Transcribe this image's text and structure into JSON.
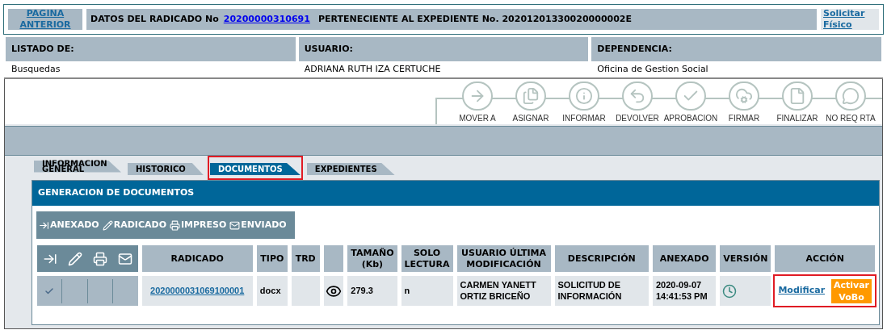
{
  "header": {
    "back_link": "PAGINA ANTERIOR",
    "title_prefix": "DATOS DEL RADICADO No",
    "radicado_link": "20200000310691",
    "title_suffix": "PERTENECIENTE AL EXPEDIENTE No. 20201201330020000002E",
    "request_link": "Solicitar Físico"
  },
  "info": [
    {
      "label": "LISTADO DE:",
      "value": "Busquedas"
    },
    {
      "label": "USUARIO:",
      "value": "ADRIANA RUTH IZA CERTUCHE"
    },
    {
      "label": "DEPENDENCIA:",
      "value": "Oficina de Gestion Social"
    }
  ],
  "workflow_actions": [
    {
      "kind": "move",
      "label": "MOVER A"
    },
    {
      "kind": "assign",
      "label": "ASIGNAR"
    },
    {
      "kind": "inform",
      "label": "INFORMAR"
    },
    {
      "kind": "return",
      "label": "DEVOLVER"
    },
    {
      "kind": "approve",
      "label": "APROBACION"
    },
    {
      "kind": "sign",
      "label": "FIRMAR"
    },
    {
      "kind": "finish",
      "label": "FINALIZAR"
    },
    {
      "kind": "noreply",
      "label": "NO REQ RTA"
    }
  ],
  "tabs": [
    {
      "label": "INFORMACION GENERAL",
      "selected": false,
      "highlighted": false
    },
    {
      "label": "HISTORICO",
      "selected": false,
      "highlighted": false
    },
    {
      "label": "DOCUMENTOS",
      "selected": true,
      "highlighted": true
    },
    {
      "label": "EXPEDIENTES",
      "selected": false,
      "highlighted": false
    }
  ],
  "section_title": "GENERACION DE DOCUMENTOS",
  "legend": [
    {
      "kind": "anexado",
      "label": "ANEXADO"
    },
    {
      "kind": "radicado",
      "label": "RADICADO"
    },
    {
      "kind": "impreso",
      "label": "IMPRESO"
    },
    {
      "kind": "enviado",
      "label": "ENVIADO"
    }
  ],
  "table": {
    "columns": [
      "RADICADO",
      "TIPO",
      "TRD",
      "TAMAÑO (Kb)",
      "SOLO LECTURA",
      "USUARIO ÚLTIMA MODIFICACIÓN",
      "DESCRIPCIÓN",
      "ANEXADO",
      "VERSIÓN",
      "ACCIÓN"
    ],
    "rows": [
      {
        "status": [
          true,
          false,
          false,
          false
        ],
        "radicado": "2020000031069100001",
        "tipo": "docx",
        "tamano": "279.3",
        "solo_lectura": "n",
        "usuario": "CARMEN YANETT ORTIZ BRICEÑO",
        "descripcion": "SOLICITUD DE INFORMACIÓN",
        "anexado": "2020-09-07 14:41:53 PM",
        "modify": "Modificar",
        "vobo_lines": [
          "Activar",
          "VoBo"
        ],
        "action_highlighted": true
      }
    ]
  }
}
